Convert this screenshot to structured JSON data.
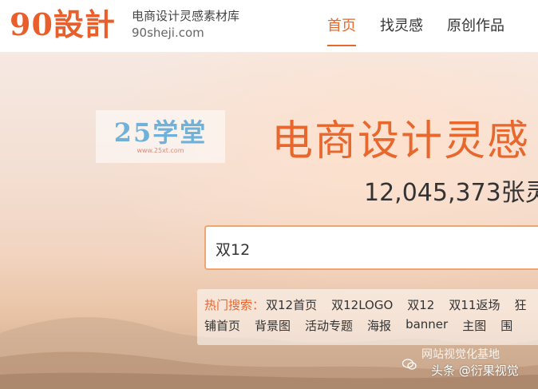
{
  "header": {
    "logo": "90設計",
    "slogan": "电商设计灵感素材库",
    "domain": "90sheji.com",
    "nav": [
      {
        "label": "首页",
        "active": true
      },
      {
        "label": "找灵感",
        "active": false
      },
      {
        "label": "原创作品",
        "active": false
      }
    ],
    "accent_color": "#e8672d"
  },
  "hero": {
    "watermark": {
      "big": "25学堂",
      "small": "www.25xt.com"
    },
    "title": "电商设计灵感",
    "subtitle": "12,045,373张灵",
    "search": {
      "value": "双12"
    },
    "hot": {
      "label": "热门搜索：",
      "row1": [
        "双12首页",
        "双12LOGO",
        "双12",
        "双11返场",
        "狂"
      ],
      "row2": [
        "铺首页",
        "背景图",
        "活动专题",
        "海报",
        "banner",
        "主图",
        "围"
      ]
    }
  },
  "overlay": {
    "line1": "网站视觉化基地",
    "line2": "头条 @衍果视觉"
  }
}
